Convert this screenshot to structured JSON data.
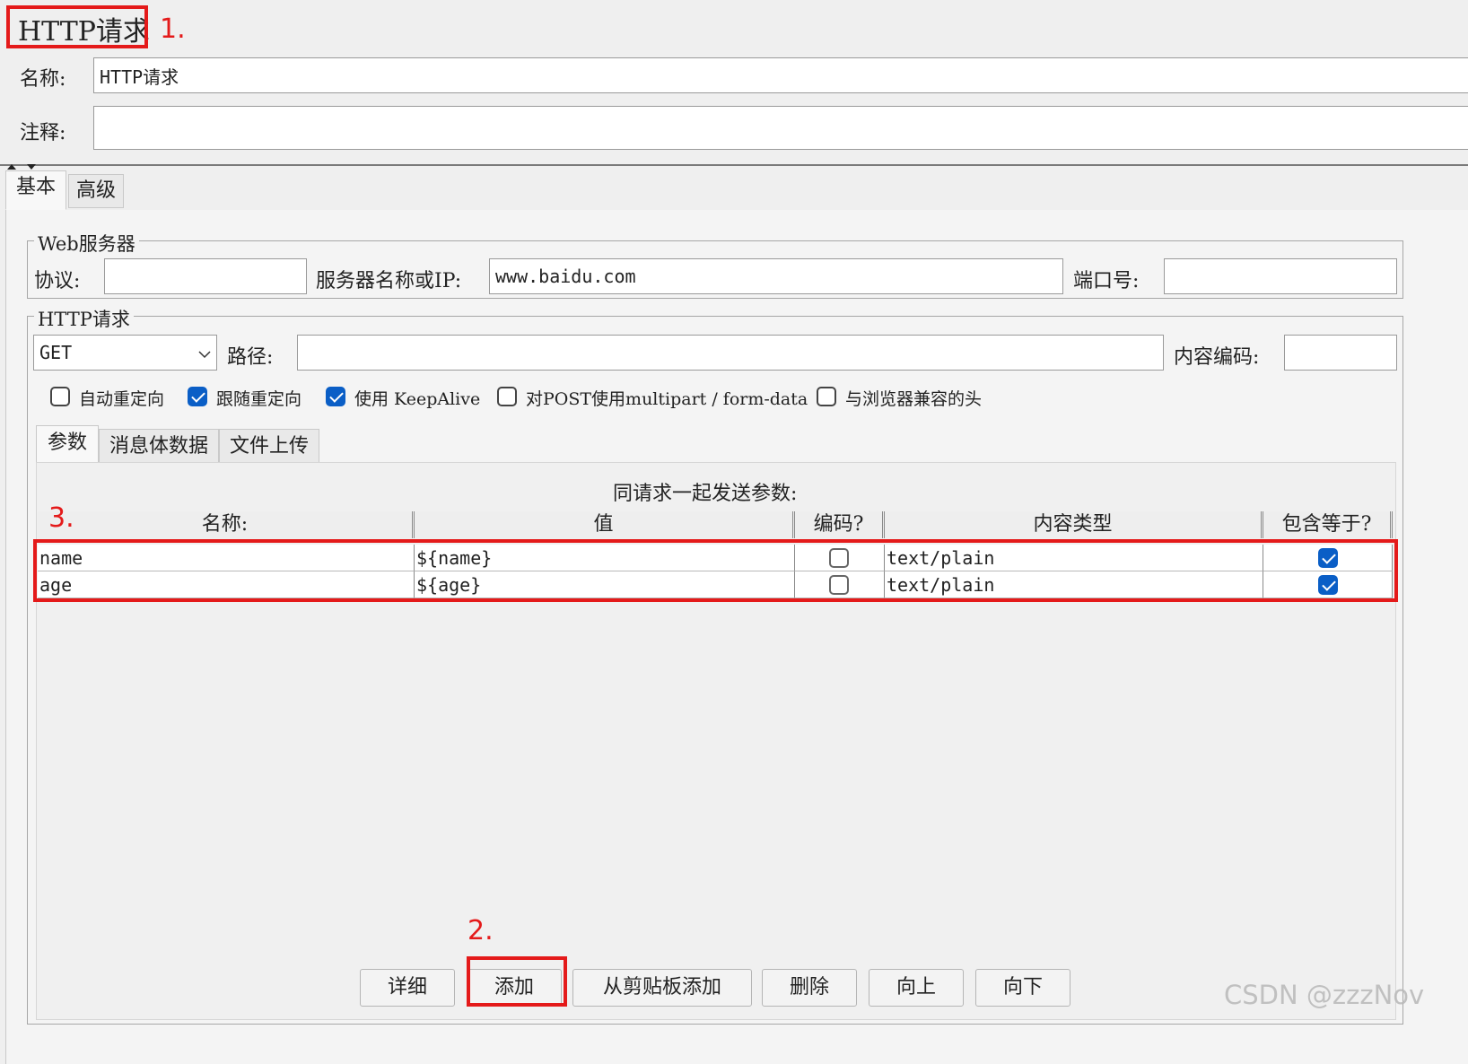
{
  "title": "HTTP请求",
  "name_label": "名称:",
  "name_value": "HTTP请求",
  "comment_label": "注释:",
  "comment_value": "",
  "tabs": [
    "基本",
    "高级"
  ],
  "web_server": {
    "legend": "Web服务器",
    "protocol_label": "协议:",
    "protocol_value": "",
    "server_label": "服务器名称或IP:",
    "server_value": "www.baidu.com",
    "port_label": "端口号:",
    "port_value": ""
  },
  "http_request": {
    "legend": "HTTP请求",
    "method": "GET",
    "path_label": "路径:",
    "path_value": "",
    "encoding_label": "内容编码:",
    "encoding_value": ""
  },
  "options": [
    {
      "label": "自动重定向",
      "checked": false
    },
    {
      "label": "跟随重定向",
      "checked": true
    },
    {
      "label": "使用 KeepAlive",
      "checked": true
    },
    {
      "label": "对POST使用multipart / form-data",
      "checked": false
    },
    {
      "label": "与浏览器兼容的头",
      "checked": false
    }
  ],
  "sub_tabs": [
    "参数",
    "消息体数据",
    "文件上传"
  ],
  "params_caption": "同请求一起发送参数:",
  "table": {
    "headers": [
      "名称:",
      "值",
      "编码?",
      "内容类型",
      "包含等于?"
    ],
    "rows": [
      {
        "name": "name",
        "value": "${name}",
        "encode": false,
        "content_type": "text/plain",
        "include_equals": true
      },
      {
        "name": "age",
        "value": "${age}",
        "encode": false,
        "content_type": "text/plain",
        "include_equals": true
      }
    ]
  },
  "buttons": [
    "详细",
    "添加",
    "从剪贴板添加",
    "删除",
    "向上",
    "向下"
  ],
  "annotations": [
    "1.",
    "2.",
    "3."
  ],
  "watermark": "CSDN @zzzNov",
  "colors": {
    "annotation": "#e41a1a",
    "checkbox_checked": "#0a5ec6"
  }
}
